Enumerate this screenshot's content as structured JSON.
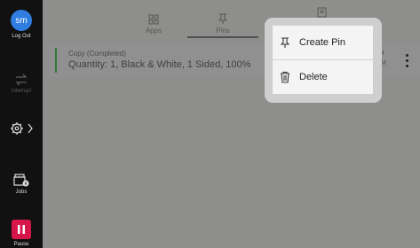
{
  "rail": {
    "user_initials": "sm",
    "logout_label": "Log Out",
    "interrupt_label": "Interrupt",
    "jobs_label": "Jobs",
    "pause_label": "Pause"
  },
  "tabs": [
    {
      "label": "Apps",
      "icon": "grid-icon"
    },
    {
      "label": "Pins",
      "icon": "pin-icon",
      "selected": true
    },
    {
      "label": "",
      "icon": "document-icon"
    }
  ],
  "job": {
    "status": "Copy (Completed)",
    "detail": "Quantity: 1, Black & White, 1 Sided, 100%",
    "time_line1": "4",
    "time_line2": "M"
  },
  "menu": {
    "items": [
      {
        "label": "Create Pin",
        "icon": "pin-icon"
      },
      {
        "label": "Delete",
        "icon": "trash-icon"
      }
    ]
  },
  "colors": {
    "accent_blue": "#2f7de1",
    "pause_red": "#d6164a",
    "completed_green": "#2f7a3a",
    "overlay_gray": "#8e8e8c"
  }
}
